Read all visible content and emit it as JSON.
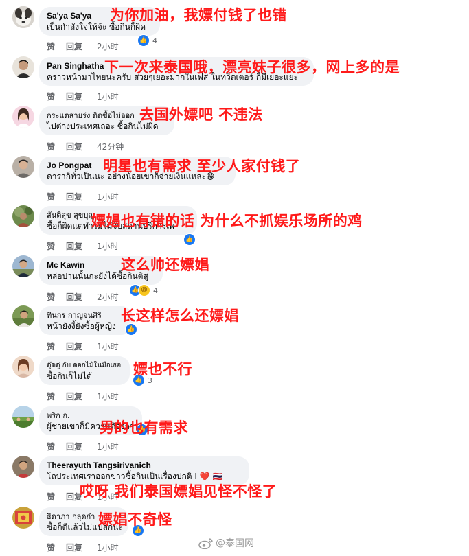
{
  "actions": {
    "like": "赞",
    "reply": "回复"
  },
  "comments": [
    {
      "name": "Sa'ya Sa'ya",
      "text": "เป็นกำลังใจให้จ้ะ ซื้อกินก็ผิด",
      "time": "2小时",
      "reaction_count": "4",
      "overlay": "为你加油，我嫖付钱了也错"
    },
    {
      "name": "Pan Singhatha",
      "text": "คราวหน้ามาไทยนะครับ สวยๆเยอะมากในเฟส ในทวิตเตอร์ ก็มีเยอะแยะ",
      "time": "1小时",
      "overlay": "下一次来泰国哦，漂亮妹子很多，网上多的是"
    },
    {
      "name": "กระแตสายร่ง ดิดซื้อไม่ออก",
      "text": "ไปต่างประเทศเถอะ ซื้อกินไม่ผิด",
      "time": "42分钟",
      "overlay": "去国外嫖吧 不违法"
    },
    {
      "name": "Jo Pongpat",
      "text": "ดาราก็ทั่วเป็นนะ อย่างน้อยเขาก็จ่ายเงินแหละ😁",
      "time": "1小时",
      "overlay": "明星也有需求 至少人家付钱了"
    },
    {
      "name": "สันติสุข สุขบุญ",
      "text": "ซื้อก็ผิดแต่ทำไมไม่จับสถานบริการเพ",
      "time": "1小时",
      "overlay": "嫖娼也有错的话 为什么不抓娱乐场所的鸡"
    },
    {
      "name": "Mc Kawin",
      "text": "หล่อปานนั้นกะยังได้ซื้อกินติสู",
      "time": "2小时",
      "reaction_count": "4",
      "overlay": "这么帅还嫖娼"
    },
    {
      "name": "ทินกร กาญจนศิริ",
      "text": "หน้ายังงี้ยังซื้อผู้หญิง",
      "time": "1小时",
      "overlay": "长这样怎么还嫖娼"
    },
    {
      "name": "ตุ๊ดตู่ กับ ดอกไม้ในมือเธอ",
      "text": "ซื้อกินก็ไม่ได้",
      "time": "1小时",
      "reaction_count": "3",
      "overlay": "嫖也不行"
    },
    {
      "name": "พริก ก.",
      "text": "ผู้ชายเขาก็มีความต้องการ",
      "time": "1小时",
      "overlay": "男的也有需求"
    },
    {
      "name": "Theerayuth Tangsirivanich",
      "text": "โถประเทศเราออกข่าวซื้อกินเป็นเรื่องปกติ I ❤️ 🇹🇭",
      "time": "1小时",
      "overlay": "哎呀 我们泰国嫖娼见怪不怪了"
    },
    {
      "name": "ธิดาภา กลุดกำ",
      "text": "ซื้อก็ดีแล้วไม่แปลกนะ",
      "time": "1小时",
      "overlay": "嫖娼不奇怪"
    }
  ],
  "watermark": {
    "at": "@",
    "text": "泰国网"
  },
  "colors": {
    "overlay": "#ff1a1a",
    "bubble": "#f0f2f5",
    "like": "#1877f2"
  }
}
